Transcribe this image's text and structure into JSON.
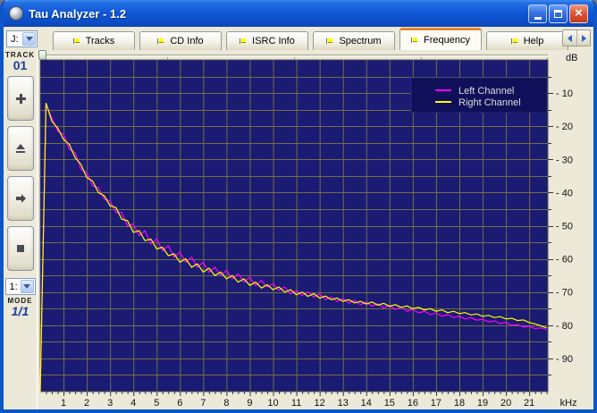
{
  "window": {
    "title": "Tau Analyzer - 1.2"
  },
  "icons": {
    "app": "sphere-icon",
    "tab_flag": "flag-icon",
    "combo_chevron": "chevron-down-icon",
    "tab_scroll_left": "chevron-left-icon",
    "tab_scroll_right": "chevron-right-icon",
    "titlebar": [
      "minimize-icon",
      "maximize-icon",
      "close-icon"
    ],
    "transport": [
      "plus-icon",
      "eject-icon",
      "arrow-right-icon",
      "stop-icon"
    ]
  },
  "tabs": [
    {
      "label": "Tracks",
      "active": false
    },
    {
      "label": "CD Info",
      "active": false
    },
    {
      "label": "ISRC Info",
      "active": false
    },
    {
      "label": "Spectrum",
      "active": false
    },
    {
      "label": "Frequency",
      "active": true
    },
    {
      "label": "Help",
      "active": false
    }
  ],
  "sidebar": {
    "drive_selector": {
      "value": "J:"
    },
    "track": {
      "label": "TRACK",
      "value": "01"
    },
    "mode_selector": {
      "value": "1:"
    },
    "mode": {
      "label": "MODE",
      "value": "1/1"
    }
  },
  "colors": {
    "titlebar_blue": "#1158D8",
    "window_border": "#0D56C8",
    "panel_beige": "#ECE9D8",
    "plot_background": "#1B1B73",
    "grid": "#6F6F4B",
    "legend_background": "#10105A",
    "left_channel": "#FF00FF",
    "right_channel": "#FFFF00",
    "active_tab_accent": "#E5872D"
  },
  "chart_data": {
    "type": "line",
    "title": "",
    "xlabel": "kHz",
    "ylabel": "dB",
    "xlim": [
      0,
      21.8
    ],
    "ylim": [
      -100,
      0
    ],
    "grid": true,
    "legend_position": "top-right",
    "x_tick_labels": [
      "1",
      "2",
      "3",
      "4",
      "5",
      "6",
      "7",
      "8",
      "9",
      "10",
      "11",
      "12",
      "13",
      "14",
      "15",
      "16",
      "17",
      "18",
      "19",
      "20",
      "21"
    ],
    "y_tick_labels": [
      "- 10",
      "- 20",
      "- 30",
      "- 40",
      "- 50",
      "- 60",
      "- 70",
      "- 80",
      "- 90"
    ],
    "x_minor_step": 0.25,
    "y_minor_step": 5,
    "x_start": 0,
    "x_step": 0.25,
    "series": [
      {
        "name": "Left Channel",
        "color": "#FF00FF",
        "values": [
          -100,
          -13.5,
          -17.5,
          -21.5,
          -22.5,
          -27,
          -28,
          -33,
          -34,
          -38,
          -38.5,
          -42,
          -42.5,
          -46,
          -46,
          -50,
          -49.5,
          -53,
          -51.5,
          -55.5,
          -54,
          -57.5,
          -56,
          -59.5,
          -58,
          -61,
          -59.5,
          -62.5,
          -61,
          -64,
          -62.5,
          -65,
          -63.5,
          -66,
          -64.5,
          -67,
          -65.5,
          -68,
          -66.5,
          -68.5,
          -67.5,
          -69.5,
          -68.5,
          -70.5,
          -69.5,
          -71,
          -70,
          -71.5,
          -70.5,
          -72.3,
          -71.5,
          -72.8,
          -72,
          -73.3,
          -72.5,
          -73.8,
          -73,
          -74.3,
          -73.5,
          -74.8,
          -74,
          -75.3,
          -74.5,
          -75.8,
          -75.2,
          -76.3,
          -75.8,
          -76.8,
          -76.3,
          -77.3,
          -76.8,
          -77.7,
          -77.3,
          -78.1,
          -77.7,
          -78.5,
          -78.2,
          -79,
          -78.7,
          -79.5,
          -79.2,
          -80,
          -79.8,
          -80.5,
          -80.3,
          -81,
          -80.8,
          -81.3
        ]
      },
      {
        "name": "Right Channel",
        "color": "#FFFF00",
        "values": [
          -100,
          -13,
          -18.5,
          -20.5,
          -24,
          -25.5,
          -29.5,
          -31.5,
          -35.5,
          -36.5,
          -40,
          -41,
          -44,
          -44.5,
          -48,
          -48.5,
          -52,
          -51.5,
          -54.5,
          -54,
          -57,
          -56.5,
          -59,
          -58.5,
          -61,
          -60,
          -62.5,
          -61.5,
          -64,
          -62.8,
          -65,
          -64,
          -66,
          -65,
          -67,
          -66,
          -68,
          -67,
          -68.8,
          -67.8,
          -69.3,
          -68.5,
          -70,
          -69.3,
          -70.8,
          -70,
          -71.3,
          -70.5,
          -71.8,
          -71.2,
          -72.3,
          -71.8,
          -72.8,
          -72.3,
          -73.3,
          -72.8,
          -73.6,
          -73,
          -74,
          -73.4,
          -74.3,
          -73.8,
          -74.6,
          -74.2,
          -75,
          -74.6,
          -75.4,
          -75,
          -75.8,
          -75.4,
          -76.2,
          -75.8,
          -76.5,
          -76.2,
          -76.9,
          -76.6,
          -77.3,
          -77,
          -77.7,
          -77.4,
          -78.1,
          -77.9,
          -78.6,
          -78.4,
          -79.2,
          -79.6,
          -80.2,
          -80.8
        ]
      }
    ]
  }
}
